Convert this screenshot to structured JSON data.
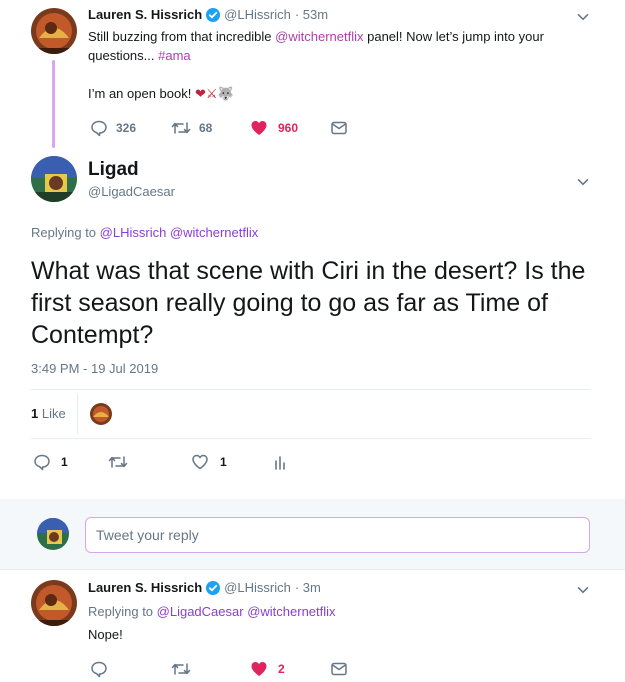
{
  "tweet1": {
    "name": "Lauren S. Hissrich",
    "handle": "@LHissrich",
    "time": "· 53m",
    "text_pre": "Still buzzing from that incredible ",
    "mention": "@witchernetflix",
    "text_mid": " panel! Now let’s jump into your",
    "text_line2": "questions... ",
    "hashtag": "#ama",
    "text_line3": "I’m an open book! ",
    "emojis": "❤⚔🐺",
    "replies": "326",
    "retweets": "68",
    "likes": "960"
  },
  "tweet2": {
    "name": "Ligad",
    "handle": "@LigadCaesar",
    "replying_label": "Replying to ",
    "replying_mention1": "@LHissrich",
    "replying_mention2": "@witchernetflix",
    "text": "What was that scene with Ciri in the desert? Is the first season really going to go as far as Time of Contempt?",
    "timestamp": "3:49 PM - 19 Jul 2019",
    "likes_count": "1",
    "likes_label": "Like",
    "replies": "1",
    "likes": "1"
  },
  "reply_box": {
    "placeholder": "Tweet your reply"
  },
  "tweet3": {
    "name": "Lauren S. Hissrich",
    "handle": "@LHissrich",
    "time": "· 3m",
    "replying_label": "Replying to ",
    "replying_mention1": "@LigadCaesar",
    "replying_mention2": "@witchernetflix",
    "text": "Nope!",
    "likes": "2"
  },
  "colors": {
    "accent": "#b03eb0",
    "like_red": "#e0245e",
    "muted": "#657786",
    "verified": "#1da1f2"
  }
}
